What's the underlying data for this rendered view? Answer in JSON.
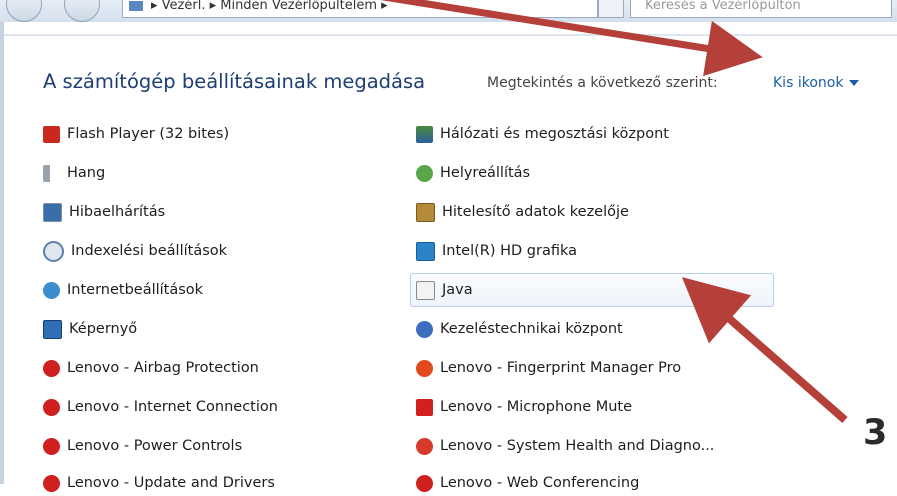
{
  "address_bar": {
    "breadcrumb": "▸ Vezérl. ▸ Minden Vezérlőpultelem ▸",
    "search_placeholder": "Keresés a Vezérlőpulton"
  },
  "header": {
    "title": "A számítógép beállításainak megadása",
    "view_by_label": "Megtekintés a következő szerint:",
    "view_by_value": "Kis ikonok"
  },
  "items_left": [
    {
      "label": "Flash Player (32 bites)",
      "icon": "flash-player-icon"
    },
    {
      "label": "Hang",
      "icon": "speaker-icon"
    },
    {
      "label": "Hibaelhárítás",
      "icon": "troubleshooting-icon"
    },
    {
      "label": "Indexelési beállítások",
      "icon": "indexing-icon"
    },
    {
      "label": "Internetbeállítások",
      "icon": "internet-options-icon"
    },
    {
      "label": "Képernyő",
      "icon": "display-icon"
    },
    {
      "label": "Lenovo - Airbag Protection",
      "icon": "lenovo-airbag-icon"
    },
    {
      "label": "Lenovo - Internet Connection",
      "icon": "lenovo-internet-icon"
    },
    {
      "label": "Lenovo - Power Controls",
      "icon": "lenovo-power-icon"
    },
    {
      "label": "Lenovo - Update and Drivers",
      "icon": "lenovo-update-icon"
    }
  ],
  "items_right": [
    {
      "label": "Hálózati és megosztási központ",
      "icon": "network-icon"
    },
    {
      "label": "Helyreállítás",
      "icon": "recovery-icon"
    },
    {
      "label": "Hitelesítő adatok kezelője",
      "icon": "credential-icon"
    },
    {
      "label": "Intel(R) HD grafika",
      "icon": "intel-graphics-icon"
    },
    {
      "label": "Java",
      "icon": "java-icon"
    },
    {
      "label": "Kezeléstechnikai központ",
      "icon": "ease-of-access-icon"
    },
    {
      "label": "Lenovo - Fingerprint Manager Pro",
      "icon": "lenovo-fingerprint-icon"
    },
    {
      "label": "Lenovo - Microphone Mute",
      "icon": "lenovo-mic-mute-icon"
    },
    {
      "label": "Lenovo - System Health and Diagno...",
      "icon": "lenovo-health-icon"
    },
    {
      "label": "Lenovo - Web Conferencing",
      "icon": "lenovo-web-conf-icon"
    }
  ],
  "annotation": {
    "step_number": "3",
    "arrow_color": "#b5403a"
  }
}
